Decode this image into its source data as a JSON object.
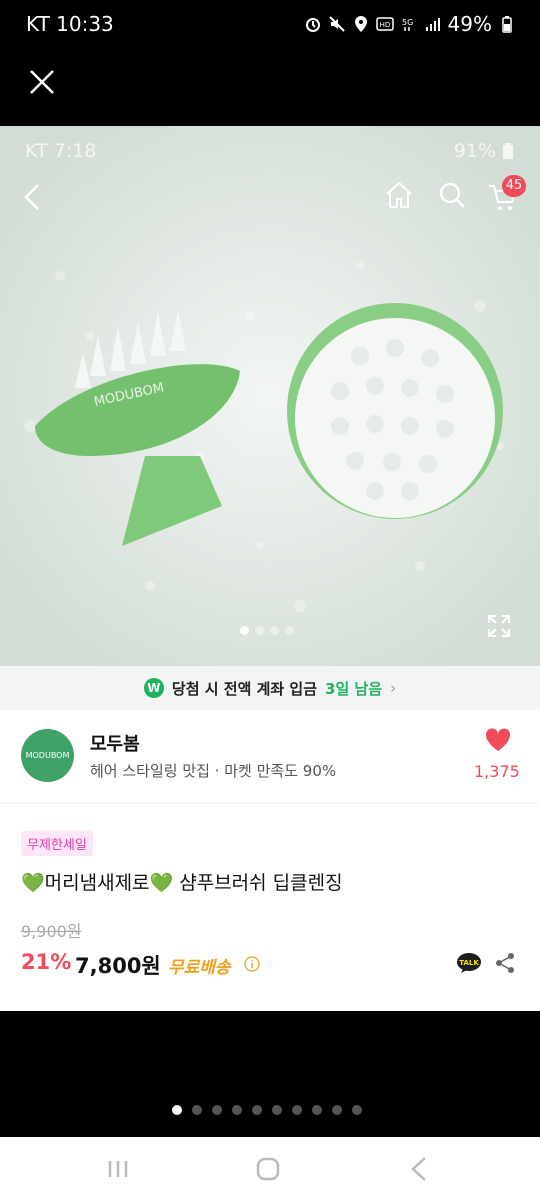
{
  "outer_status": {
    "time": "KT 10:33",
    "battery": "49%"
  },
  "inner_status": {
    "time": "KT 7:18",
    "battery": "91%"
  },
  "header": {
    "cart_count": "45"
  },
  "photo": {
    "brand_text": "MODUBOM",
    "page_total": 4,
    "page_current": 1
  },
  "banner": {
    "text": "당첨 시 전액 계좌 입금",
    "highlight": "3일 남음",
    "badge": "W"
  },
  "shop": {
    "logo_text": "MODUBOM",
    "name": "모두봄",
    "description": "헤어 스타일링 맛집 · 마켓 만족도 90%",
    "likes": "1,375"
  },
  "product": {
    "tag": "무제한세일",
    "title": "💚머리냄새제로💚 샴푸브러쉬 딥클렌징",
    "original_price": "9,900원",
    "discount": "21%",
    "price": "7,800원",
    "shipping": "무료배송",
    "talk_label": "TALK"
  },
  "pager": {
    "total": 10,
    "current": 1
  },
  "colors": {
    "accent": "#ef4b59",
    "green": "#21b35a",
    "shipping": "#f0a020"
  }
}
